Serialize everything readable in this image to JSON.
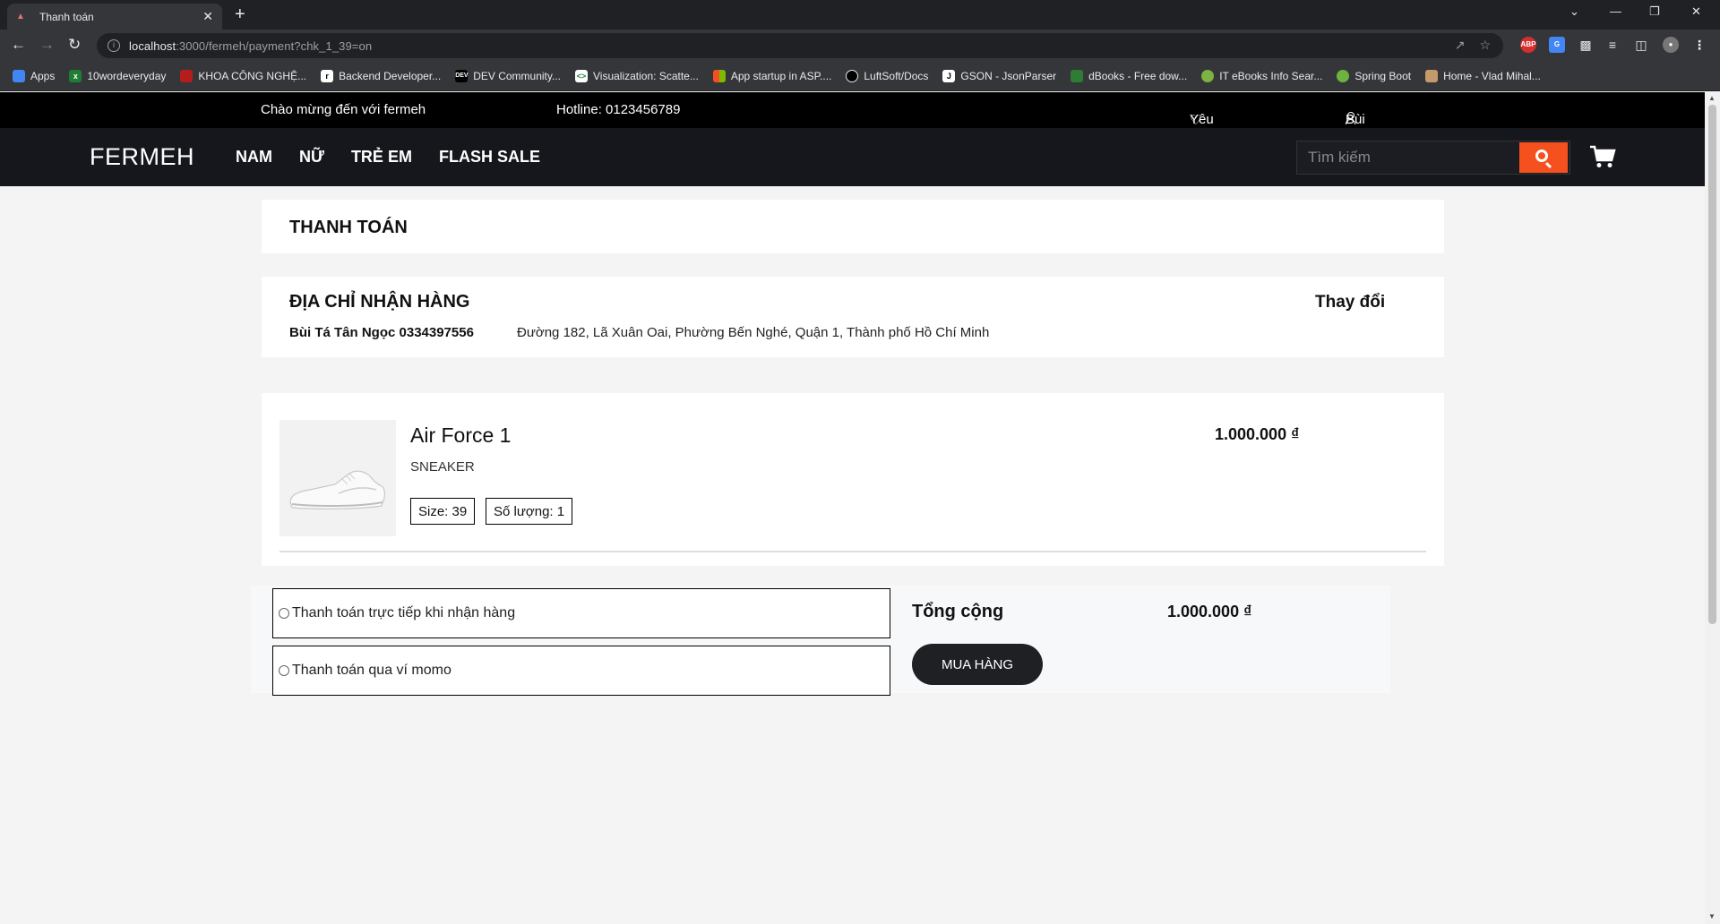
{
  "browser": {
    "tab_title": "Thanh toán",
    "url_host": "localhost",
    "url_rest": ":3000/fermeh/payment?chk_1_39=on",
    "bookmarks": [
      {
        "label": "Apps",
        "color": "#4285f4",
        "icon": "apps-grid-icon"
      },
      {
        "label": "10wordeveryday",
        "color": "#1e7e34",
        "icon": "excel-icon"
      },
      {
        "label": "KHOA CÔNG NGHỆ...",
        "color": "#b71c1c",
        "icon": "school-icon"
      },
      {
        "label": "Backend Developer...",
        "color": "#ffffff",
        "icon": "roadmap-icon"
      },
      {
        "label": "DEV Community...",
        "color": "#000000",
        "icon": "dev-icon"
      },
      {
        "label": "Visualization: Scatte...",
        "color": "#ffffff",
        "icon": "code-icon"
      },
      {
        "label": "App startup in ASP....",
        "color": "#f25022",
        "icon": "microsoft-icon"
      },
      {
        "label": "LuftSoft/Docs",
        "color": "#000000",
        "icon": "github-icon"
      },
      {
        "label": "GSON - JsonParser",
        "color": "#000000",
        "icon": "j-icon"
      },
      {
        "label": "dBooks - Free dow...",
        "color": "#2e7d32",
        "icon": "book-icon"
      },
      {
        "label": "IT eBooks Info Sear...",
        "color": "#7cb342",
        "icon": "ebook-icon"
      },
      {
        "label": "Spring Boot",
        "color": "#6db33f",
        "icon": "spring-icon"
      },
      {
        "label": "Home - Vlad Mihal...",
        "color": "#c49a6c",
        "icon": "avatar-icon"
      }
    ]
  },
  "topbar": {
    "welcome": "Chào mừng đến với fermeh",
    "hotline": "Hotline: 0123456789",
    "wishlist": "Yêu thích",
    "user": "Bùi Tá Tân Ngọc"
  },
  "nav": {
    "logo": "FERMEH",
    "menu": [
      "NAM",
      "NỮ",
      "TRẺ EM",
      "FLASH SALE"
    ],
    "search_placeholder": "Tìm kiếm"
  },
  "page": {
    "title": "THANH TOÁN"
  },
  "address": {
    "heading": "ĐỊA CHỈ NHẬN HÀNG",
    "change": "Thay đổi",
    "name_phone": "Bùi Tá Tân Ngọc 0334397556",
    "street": "Đường 182, Lã Xuân Oai, Phường Bến Nghé, Quận 1, Thành phố Hồ Chí Minh"
  },
  "product": {
    "name": "Air Force 1",
    "category": "SNEAKER",
    "size": "Size: 39",
    "quantity": "Số lượng: 1",
    "price": "1.000.000 ₫"
  },
  "checkout": {
    "options": [
      "Thanh toán trực tiếp khi nhận hàng",
      "Thanh toán qua ví momo"
    ],
    "total_label": "Tổng cộng",
    "total_value": "1.000.000 ₫",
    "buy": "MUA HÀNG"
  },
  "colors": {
    "accent": "#f4511e",
    "nav_bg": "#15171c",
    "topbar_bg": "#000000",
    "button_bg": "#1e2024"
  }
}
